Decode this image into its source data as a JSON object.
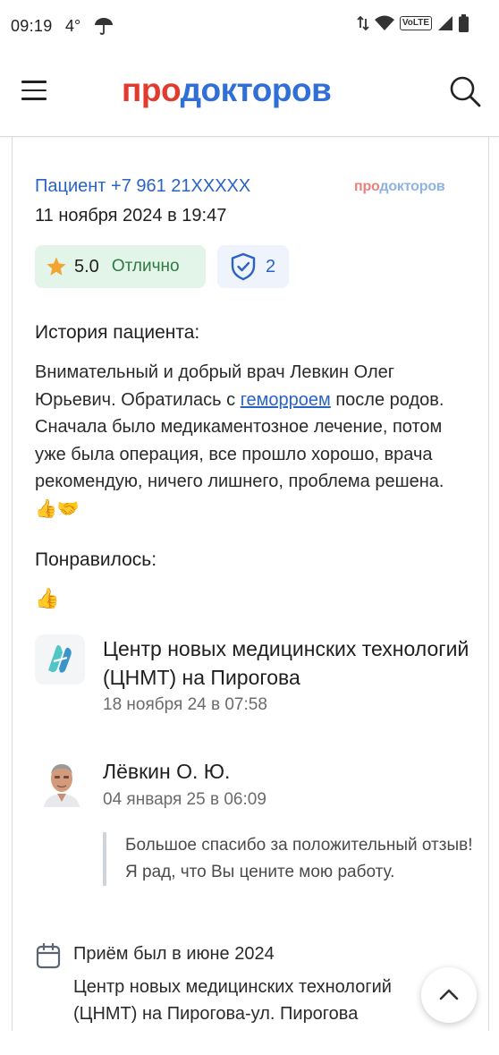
{
  "status_bar": {
    "time": "09:19",
    "temperature": "4°",
    "weather_icon": "umbrella-icon",
    "volte": "VoLTE"
  },
  "header": {
    "menu_icon": "hamburger-menu-icon",
    "logo_part1": "про",
    "logo_part2": "докторов",
    "search_icon": "search-icon",
    "colors": {
      "brand_red": "#e23b2e",
      "brand_blue": "#2f6fd6"
    }
  },
  "review": {
    "author": "Пациент +7 961 21XXXXX",
    "date": "11 ноября 2024 в 19:47",
    "source_logo_part1": "про",
    "source_logo_part2": "докторов",
    "rating_score": "5.0",
    "rating_word": "Отлично",
    "verification_count": "2",
    "story_heading": "История пациента:",
    "story_before_link": "Внимательный и добрый врач Левкин Олег Юрьевич. Обратилась с ",
    "story_link": "геморроем",
    "story_after_link": " после родов. Сначала было медикаментозное лечение, потом уже была операция, все прошло хорошо, врача рекомендую, ничего лишнего, проблема решена. 👍🤝",
    "liked_heading": "Понравилось:",
    "liked_text": "👍"
  },
  "clinic": {
    "name": "Центр новых медицинских технологий (ЦНМТ) на Пирогова",
    "date": "18 ноября 24 в 07:58"
  },
  "doctor_reply": {
    "name": "Лёвкин О. Ю.",
    "date": "04 января 25 в 06:09",
    "text": "Большое спасибо за положительный отзыв! Я рад, что Вы цените мою работу."
  },
  "visit": {
    "title": "Приём был в июне 2024",
    "place": "Центр новых медицинских технологий (ЦНМТ) на Пирогова-ул. Пирогова"
  },
  "scroll_top_icon": "chevron-up-icon"
}
